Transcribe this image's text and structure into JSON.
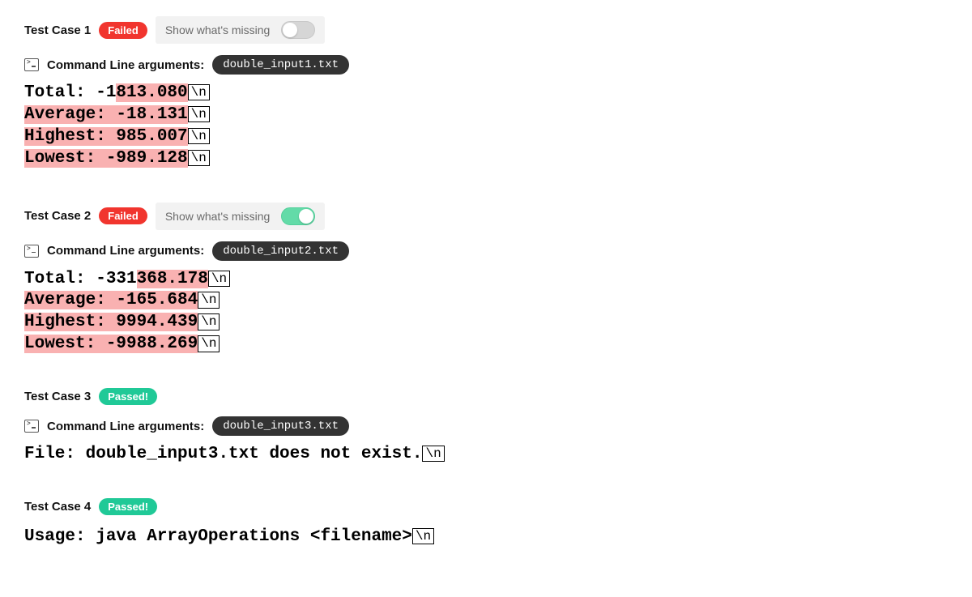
{
  "labels": {
    "show_missing": "Show what's missing",
    "args_label": "Command Line arguments:",
    "newline_token": "\\n"
  },
  "status": {
    "failed": "Failed",
    "passed": "Passed!"
  },
  "tests": [
    {
      "title": "Test Case 1",
      "status": "failed",
      "show_missing_toggle": false,
      "args": "double_input1.txt",
      "output": [
        {
          "segments": [
            {
              "text": "Total: -1",
              "hl": false
            },
            {
              "text": "813.080",
              "hl": true
            }
          ]
        },
        {
          "segments": [
            {
              "text": "Average: -18.131",
              "hl": true
            }
          ]
        },
        {
          "segments": [
            {
              "text": "Highest: 985.007",
              "hl": true
            }
          ]
        },
        {
          "segments": [
            {
              "text": "Lowest: -989.128",
              "hl": true
            }
          ]
        }
      ]
    },
    {
      "title": "Test Case 2",
      "status": "failed",
      "show_missing_toggle": true,
      "args": "double_input2.txt",
      "output": [
        {
          "segments": [
            {
              "text": "Total: -331",
              "hl": false
            },
            {
              "text": "368.178",
              "hl": true
            }
          ]
        },
        {
          "segments": [
            {
              "text": "Average: -165.684",
              "hl": true
            }
          ]
        },
        {
          "segments": [
            {
              "text": "Highest: 9994.439",
              "hl": true
            }
          ]
        },
        {
          "segments": [
            {
              "text": "Lowest: -9988.269",
              "hl": true
            }
          ]
        }
      ]
    },
    {
      "title": "Test Case 3",
      "status": "passed",
      "args": "double_input3.txt",
      "output": [
        {
          "segments": [
            {
              "text": "File: double_input3.txt does not exist.",
              "hl": false
            }
          ]
        }
      ]
    },
    {
      "title": "Test Case 4",
      "status": "passed",
      "output": [
        {
          "segments": [
            {
              "text": "Usage: java ArrayOperations <filename>",
              "hl": false
            }
          ]
        }
      ]
    }
  ]
}
